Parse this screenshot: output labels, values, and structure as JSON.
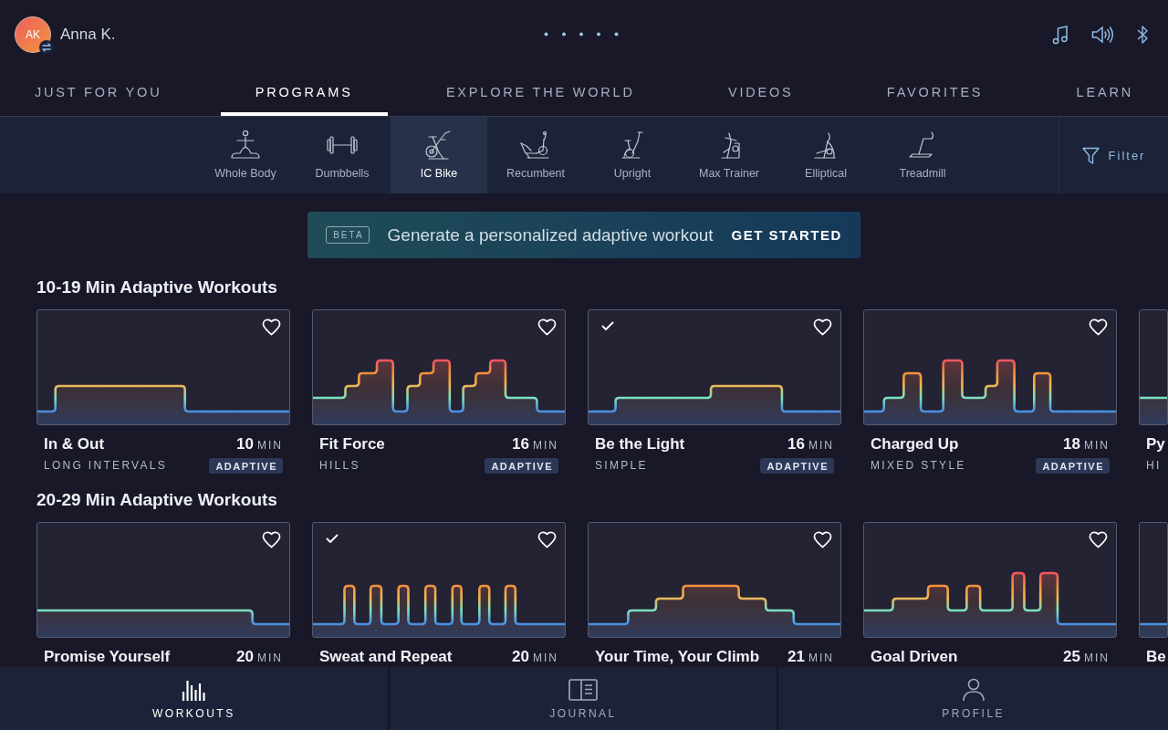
{
  "header": {
    "avatar": {
      "initials": "AK"
    },
    "user_name": "Anna K."
  },
  "tabs": [
    {
      "label": "JUST FOR YOU",
      "selected": false
    },
    {
      "label": "PROGRAMS",
      "selected": true
    },
    {
      "label": "EXPLORE THE WORLD",
      "selected": false
    },
    {
      "label": "VIDEOS",
      "selected": false
    },
    {
      "label": "FAVORITES",
      "selected": false
    },
    {
      "label": "LEARN",
      "selected": false
    }
  ],
  "equipment": [
    {
      "label": "Whole Body",
      "selected": false
    },
    {
      "label": "Dumbbells",
      "selected": false
    },
    {
      "label": "IC Bike",
      "selected": true
    },
    {
      "label": "Recumbent",
      "selected": false
    },
    {
      "label": "Upright",
      "selected": false
    },
    {
      "label": "Max Trainer",
      "selected": false
    },
    {
      "label": "Elliptical",
      "selected": false
    },
    {
      "label": "Treadmill",
      "selected": false
    }
  ],
  "filter": {
    "label": "Filter"
  },
  "banner": {
    "badge": "BETA",
    "text": "Generate a personalized adaptive workout",
    "action": "GET STARTED"
  },
  "sections": [
    {
      "title": "10-19 Min Adaptive Workouts",
      "workouts": [
        {
          "title": "In & Out",
          "duration": "10",
          "unit": "MIN",
          "category": "LONG INTERVALS",
          "badge": "ADAPTIVE",
          "completed": false,
          "favorite": false
        },
        {
          "title": "Fit Force",
          "duration": "16",
          "unit": "MIN",
          "category": "HILLS",
          "badge": "ADAPTIVE",
          "completed": false,
          "favorite": false
        },
        {
          "title": "Be the Light",
          "duration": "16",
          "unit": "MIN",
          "category": "SIMPLE",
          "badge": "ADAPTIVE",
          "completed": true,
          "favorite": false
        },
        {
          "title": "Charged Up",
          "duration": "18",
          "unit": "MIN",
          "category": "MIXED STYLE",
          "badge": "ADAPTIVE",
          "completed": false,
          "favorite": false
        },
        {
          "title": "Py",
          "category": "HI"
        }
      ]
    },
    {
      "title": "20-29 Min Adaptive Workouts",
      "workouts": [
        {
          "title": "Promise Yourself",
          "duration": "20",
          "unit": "MIN",
          "completed": false,
          "favorite": false
        },
        {
          "title": "Sweat and Repeat",
          "duration": "20",
          "unit": "MIN",
          "completed": true,
          "favorite": false
        },
        {
          "title": "Your Time, Your Climb",
          "duration": "21",
          "unit": "MIN",
          "completed": false,
          "favorite": false
        },
        {
          "title": "Goal Driven",
          "duration": "25",
          "unit": "MIN",
          "completed": false,
          "favorite": false
        },
        {
          "title": "Be"
        }
      ]
    }
  ],
  "bottom_nav": [
    {
      "label": "WORKOUTS",
      "selected": true
    },
    {
      "label": "JOURNAL",
      "selected": false
    },
    {
      "label": "PROFILE",
      "selected": false
    }
  ]
}
